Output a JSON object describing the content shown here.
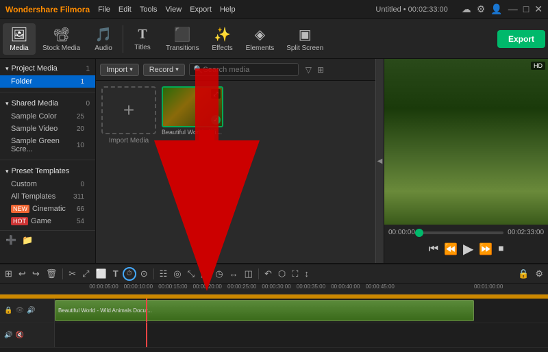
{
  "app": {
    "name": "Wondershare Filmora",
    "title": "Untitled • 00:02:33:00"
  },
  "menu": {
    "items": [
      "File",
      "Edit",
      "Tools",
      "View",
      "Export",
      "Help"
    ]
  },
  "ribbon": {
    "items": [
      {
        "id": "media",
        "icon": "🖼",
        "label": "Media",
        "active": true
      },
      {
        "id": "stock-media",
        "icon": "📽",
        "label": "Stock Media",
        "active": false
      },
      {
        "id": "audio",
        "icon": "🎵",
        "label": "Audio",
        "active": false
      },
      {
        "id": "titles",
        "icon": "T",
        "label": "Titles",
        "active": false
      },
      {
        "id": "transitions",
        "icon": "⟷",
        "label": "Transitions",
        "active": false
      },
      {
        "id": "effects",
        "icon": "✨",
        "label": "Effects",
        "active": false
      },
      {
        "id": "elements",
        "icon": "◈",
        "label": "Elements",
        "active": false
      },
      {
        "id": "split-screen",
        "icon": "▣",
        "label": "Split Screen",
        "active": false
      }
    ],
    "export_label": "Export"
  },
  "sidebar": {
    "sections": [
      {
        "title": "Project Media",
        "count": "1",
        "expanded": true,
        "items": [
          {
            "label": "Folder",
            "count": "1",
            "selected": true
          }
        ]
      },
      {
        "title": "Shared Media",
        "count": "0",
        "expanded": true,
        "items": [
          {
            "label": "Sample Color",
            "count": "25"
          },
          {
            "label": "Sample Video",
            "count": "20"
          },
          {
            "label": "Sample Green Scre...",
            "count": "10"
          }
        ]
      },
      {
        "title": "Preset Templates",
        "count": "",
        "expanded": true,
        "items": [
          {
            "label": "Custom",
            "count": "0"
          },
          {
            "label": "All Templates",
            "count": "311"
          },
          {
            "label": "Cinematic",
            "count": "66",
            "badge": "new"
          },
          {
            "label": "Game",
            "count": "54",
            "badge": "hot"
          }
        ]
      }
    ]
  },
  "media_toolbar": {
    "import_label": "Import",
    "record_label": "Record",
    "search_placeholder": "Search media"
  },
  "media_grid": {
    "import_label": "Import Media",
    "items": [
      {
        "label": "Beautiful World - Wild A...",
        "has_check": true
      }
    ]
  },
  "preview": {
    "time_current": "00:00:00",
    "time_total": "00:02:33:00"
  },
  "timeline_toolbar": {
    "buttons": [
      "⊞",
      "↩",
      "↪",
      "🗑",
      "✂",
      "✕",
      "⤢",
      "⬜",
      "T",
      "⏱",
      "⊙",
      "☷",
      "◎",
      "⤡",
      "▣",
      "◷",
      "↔",
      "◫",
      "↶",
      "⬡",
      "⛶",
      "↕",
      "◨"
    ]
  },
  "timeline": {
    "tracks": [
      {
        "label": "",
        "clip_label": "Beautiful World - Wild Animals Docur...",
        "clip_start_pct": 0,
        "clip_width_pct": 85
      }
    ],
    "ruler_marks": [
      {
        "label": "00:00:05:00",
        "pos_pct": 7
      },
      {
        "label": "00:00:10:00",
        "pos_pct": 14
      },
      {
        "label": "00:00:15:00",
        "pos_pct": 21
      },
      {
        "label": "00:00:20:00",
        "pos_pct": 28
      },
      {
        "label": "00:00:25:00",
        "pos_pct": 35
      },
      {
        "label": "00:00:30:00",
        "pos_pct": 42
      },
      {
        "label": "00:00:35:00",
        "pos_pct": 49
      },
      {
        "label": "00:00:40:00",
        "pos_pct": 56
      },
      {
        "label": "00:00:45:00",
        "pos_pct": 63
      },
      {
        "label": "00:01:00:00",
        "pos_pct": 85
      }
    ],
    "playhead_pct": 18.5
  },
  "colors": {
    "accent": "#00b96b",
    "playhead": "#ff4444",
    "selected": "#0066cc"
  },
  "arrow": {
    "visible": true,
    "color": "#cc0000"
  }
}
